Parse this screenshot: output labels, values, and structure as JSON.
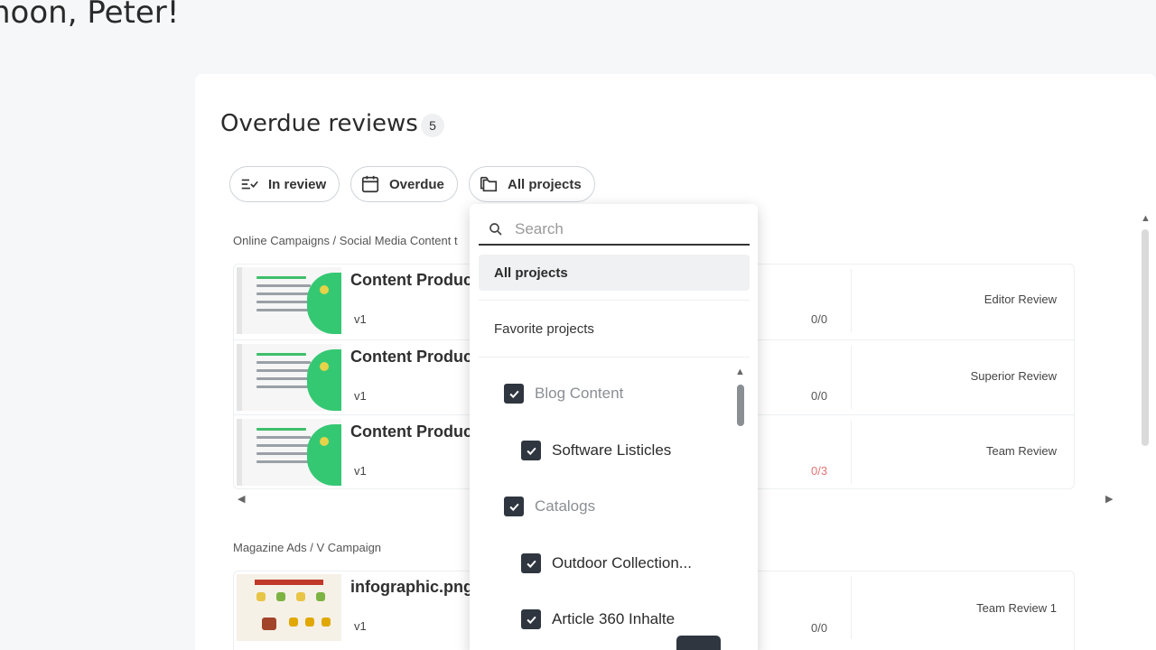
{
  "greeting": "noon, Peter!",
  "section": {
    "title": "Overdue reviews",
    "count": "5"
  },
  "filters": {
    "in_review": "In review",
    "overdue": "Overdue",
    "all_projects": "All projects"
  },
  "groups": [
    {
      "label": "Online Campaigns / Social Media Content t",
      "rows": [
        {
          "title": "Content Production Workflow",
          "version": "v1",
          "score": "0/0",
          "stage": "Editor Review"
        },
        {
          "title": "Content Production Workflow",
          "version": "v1",
          "score": "0/0",
          "stage": "Superior Review"
        },
        {
          "title": "Content Production Workflow",
          "version": "v1",
          "score": "0/3",
          "stage": "Team Review"
        }
      ]
    },
    {
      "label": "Magazine Ads / V Campaign",
      "rows": [
        {
          "title": "infographic.png",
          "version": "v1",
          "score": "0/0",
          "stage": "Team Review 1"
        }
      ]
    }
  ],
  "dropdown": {
    "search_placeholder": "Search",
    "all_projects": "All projects",
    "favorite_projects": "Favorite projects",
    "projects": [
      {
        "label": "Blog Content",
        "checked": true,
        "level": "parent"
      },
      {
        "label": "Software Listicles",
        "checked": true,
        "level": "child"
      },
      {
        "label": "Catalogs",
        "checked": true,
        "level": "parent"
      },
      {
        "label": "Outdoor Collection...",
        "checked": true,
        "level": "child"
      },
      {
        "label": "Article 360 Inhalte",
        "checked": true,
        "level": "child"
      }
    ]
  },
  "colors": {
    "warn": "#e57373",
    "checkbox": "#2f3640",
    "accent_green": "#35c873"
  }
}
